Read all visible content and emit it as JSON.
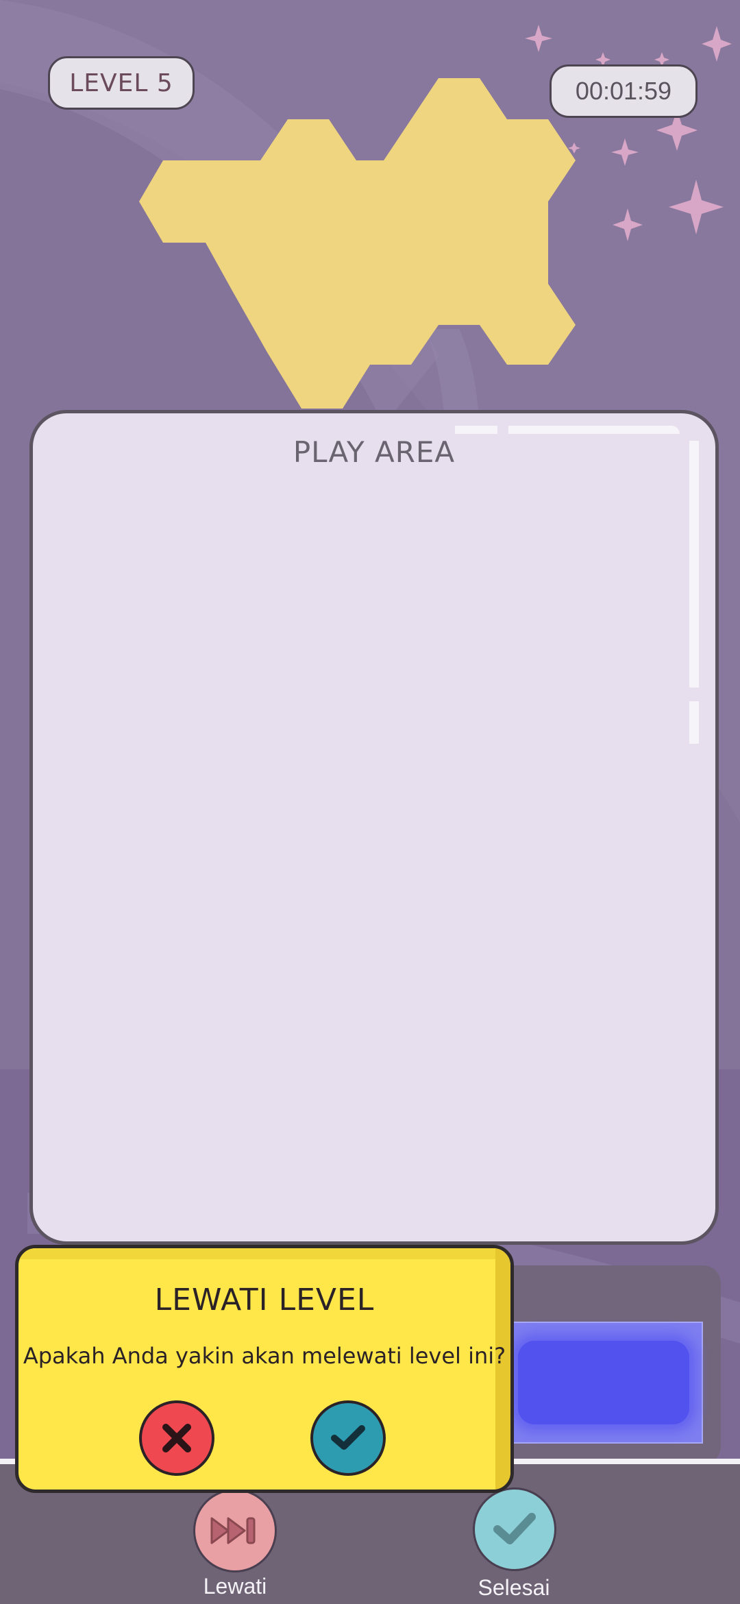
{
  "hud": {
    "level_label": "LEVEL 5",
    "timer": "00:01:59"
  },
  "play_area": {
    "title": "PLAY AREA"
  },
  "bottom_bar": {
    "skip_label": "Lewati",
    "done_label": "Selesai"
  },
  "dialog": {
    "title": "LEWATI LEVEL",
    "message": "Apakah Anda yakin akan melewati level ini?"
  },
  "colors": {
    "background": "#857499",
    "target_shape": "#efd57f",
    "play_area": "#e7dfee",
    "dialog": "#ffe74a",
    "cancel_button": "#f04850",
    "confirm_button": "#2e9cb0"
  },
  "icons": {
    "skip": "fast-forward-icon",
    "done": "checkmark-icon",
    "cancel": "x-icon",
    "confirm": "checkmark-icon",
    "decoration": "sparkle-icon"
  }
}
